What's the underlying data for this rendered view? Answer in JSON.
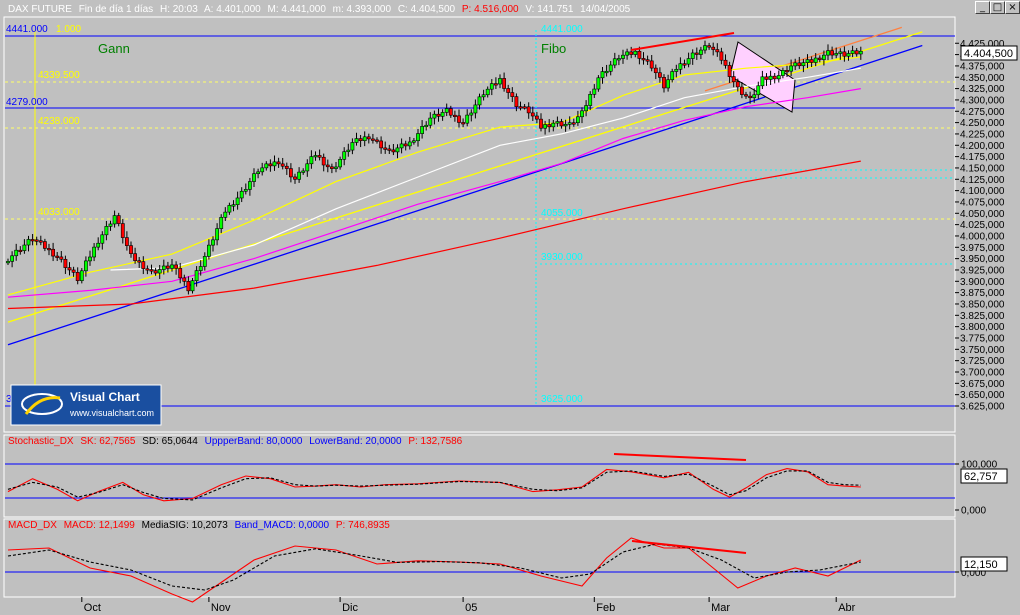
{
  "window": {
    "buttons": [
      "_",
      "□",
      "×"
    ]
  },
  "price_header": {
    "symbol": "DAX FUTURE",
    "period": "Fin de día 1 días",
    "H": "H: 20:03",
    "A": "A: 4.401,000",
    "M": "M: 4.441,000",
    "m": "m: 4.393,000",
    "C": "C: 4.404,500",
    "P": "P: 4.516,000",
    "V": "V: 141.751",
    "date": "14/04/2005"
  },
  "annotations": {
    "gann": "Gann",
    "fibo": "Fibo",
    "label_4441_left": "4441.000",
    "label_4441_yellow": "1.000",
    "label_4339": "4339.500",
    "label_4279": "4279.000",
    "label_4238": "4238.000",
    "label_4033": "4033.000",
    "label_4441_fibo": "4441.000",
    "label_4055": "4055.000",
    "label_3930": "3930.000",
    "label_3625": "3625.000",
    "label_left_3": "3"
  },
  "current_price": "4.404,500",
  "logo": {
    "name": "Visual Chart",
    "url": "www.visualchart.com"
  },
  "stoch_header": {
    "name": "Stochastic_DX",
    "sk": "SK: 62,7565",
    "sd": "SD: 65,0644",
    "upper": "UppperBand: 80,0000",
    "lower": "LowerBand: 20,0000",
    "p": "P: 132,7586"
  },
  "stoch_current": "62,757",
  "macd_header": {
    "name": "MACD_DX",
    "macd": "MACD: 12,1499",
    "signal": "MediaSIG: 10,2073",
    "band": "Band_MACD: 0,0000",
    "p": "P: 746,8935"
  },
  "macd_current": "12,150",
  "colors": {
    "background": "#c0c0c0",
    "up_candle": "#00ff00",
    "down_candle": "#ff0000",
    "grid_yellow": "#ffff00",
    "trend_blue": "#0000ff",
    "ma_red": "#ff0000",
    "ma_magenta": "#ff00ff"
  },
  "chart_data": [
    {
      "type": "candlestick",
      "title": "DAX FUTURE",
      "x_labels": [
        "Oct",
        "Nov",
        "Dic",
        "05",
        "Feb",
        "Mar",
        "Abr"
      ],
      "y_ticks": [
        "4.425,000",
        "4.400,000",
        "4.375,000",
        "4.350,000",
        "4.325,000",
        "4.300,000",
        "4.275,000",
        "4.250,000",
        "4.225,000",
        "4.200,000",
        "4.175,000",
        "4.150,000",
        "4.125,000",
        "4.100,000",
        "4.075,000",
        "4.050,000",
        "4.025,000",
        "4.000,000",
        "3.975,000",
        "3.950,000",
        "3.925,000",
        "3.900,000",
        "3.875,000",
        "3.850,000",
        "3.825,000",
        "3.800,000",
        "3.775,000",
        "3.750,000",
        "3.725,000",
        "3.700,000",
        "3.675,000",
        "3.650,000",
        "3.625,000"
      ],
      "ylim": [
        3610,
        4450
      ],
      "close_path": [
        [
          0,
          3950
        ],
        [
          6,
          3995
        ],
        [
          12,
          3955
        ],
        [
          17,
          3905
        ],
        [
          22,
          3990
        ],
        [
          26,
          4045
        ],
        [
          30,
          3955
        ],
        [
          35,
          3920
        ],
        [
          40,
          3935
        ],
        [
          44,
          3885
        ],
        [
          48,
          3955
        ],
        [
          53,
          4055
        ],
        [
          57,
          4095
        ],
        [
          61,
          4145
        ],
        [
          66,
          4165
        ],
        [
          70,
          4125
        ],
        [
          75,
          4180
        ],
        [
          79,
          4145
        ],
        [
          84,
          4205
        ],
        [
          88,
          4220
        ],
        [
          93,
          4185
        ],
        [
          98,
          4205
        ],
        [
          103,
          4260
        ],
        [
          107,
          4275
        ],
        [
          111,
          4250
        ],
        [
          116,
          4315
        ],
        [
          120,
          4345
        ],
        [
          124,
          4290
        ],
        [
          127,
          4275
        ],
        [
          130,
          4240
        ],
        [
          133,
          4250
        ],
        [
          137,
          4245
        ],
        [
          140,
          4270
        ],
        [
          144,
          4350
        ],
        [
          149,
          4395
        ],
        [
          153,
          4405
        ],
        [
          157,
          4375
        ],
        [
          160,
          4330
        ],
        [
          163,
          4370
        ],
        [
          167,
          4400
        ],
        [
          171,
          4420
        ],
        [
          174,
          4390
        ],
        [
          178,
          4325
        ],
        [
          181,
          4300
        ],
        [
          184,
          4345
        ],
        [
          188,
          4355
        ],
        [
          191,
          4375
        ],
        [
          196,
          4385
        ],
        [
          200,
          4405
        ],
        [
          204,
          4400
        ],
        [
          208,
          4405
        ]
      ],
      "series": [
        {
          "name": "MA rápida (amarilla)",
          "points": [
            [
              0,
              3870
            ],
            [
              20,
              3920
            ],
            [
              40,
              3960
            ],
            [
              60,
              4035
            ],
            [
              80,
              4120
            ],
            [
              100,
              4185
            ],
            [
              120,
              4240
            ],
            [
              135,
              4250
            ],
            [
              150,
              4310
            ],
            [
              165,
              4355
            ],
            [
              180,
              4370
            ],
            [
              195,
              4380
            ],
            [
              208,
              4395
            ]
          ]
        },
        {
          "name": "MA (blanca)",
          "points": [
            [
              25,
              3925
            ],
            [
              40,
              3930
            ],
            [
              60,
              3980
            ],
            [
              80,
              4060
            ],
            [
              100,
              4130
            ],
            [
              120,
              4200
            ],
            [
              135,
              4225
            ],
            [
              150,
              4260
            ],
            [
              165,
              4305
            ],
            [
              180,
              4330
            ],
            [
              195,
              4350
            ],
            [
              208,
              4370
            ]
          ]
        },
        {
          "name": "MA (magenta)",
          "points": [
            [
              0,
              3865
            ],
            [
              20,
              3880
            ],
            [
              40,
              3900
            ],
            [
              60,
              3950
            ],
            [
              80,
              4010
            ],
            [
              100,
              4070
            ],
            [
              120,
              4120
            ],
            [
              135,
              4160
            ],
            [
              150,
              4215
            ],
            [
              165,
              4255
            ],
            [
              180,
              4285
            ],
            [
              195,
              4305
            ],
            [
              208,
              4325
            ]
          ]
        },
        {
          "name": "MA lenta (roja)",
          "points": [
            [
              0,
              3840
            ],
            [
              30,
              3850
            ],
            [
              60,
              3885
            ],
            [
              90,
              3935
            ],
            [
              120,
              3995
            ],
            [
              150,
              4060
            ],
            [
              180,
              4120
            ],
            [
              208,
              4165
            ]
          ]
        }
      ],
      "trendlines": [
        {
          "from": [
            0,
            3760
          ],
          "to": [
            223,
            4420
          ],
          "color": "blue"
        },
        {
          "from": [
            0,
            3810
          ],
          "to": [
            223,
            4450
          ],
          "color": "yellow"
        },
        {
          "from": [
            170,
            4320
          ],
          "to": [
            218,
            4460
          ],
          "color": "orange"
        }
      ],
      "levels": [
        4441,
        4339.5,
        4279,
        4238,
        4033,
        3625
      ]
    },
    {
      "type": "line",
      "title": "Stochastic_DX",
      "ylim": [
        0,
        115
      ],
      "y_ticks": [
        "100,000",
        "0,000"
      ],
      "bands": [
        80,
        20
      ],
      "series": [
        {
          "name": "SK",
          "points": [
            [
              0,
              40
            ],
            [
              6,
              68
            ],
            [
              12,
              45
            ],
            [
              17,
              20
            ],
            [
              22,
              40
            ],
            [
              28,
              60
            ],
            [
              33,
              33
            ],
            [
              38,
              20
            ],
            [
              45,
              25
            ],
            [
              52,
              55
            ],
            [
              58,
              74
            ],
            [
              64,
              68
            ],
            [
              70,
              50
            ],
            [
              75,
              52
            ],
            [
              80,
              55
            ],
            [
              86,
              50
            ],
            [
              92,
              55
            ],
            [
              100,
              57
            ],
            [
              110,
              63
            ],
            [
              120,
              60
            ],
            [
              128,
              40
            ],
            [
              134,
              44
            ],
            [
              140,
              50
            ],
            [
              146,
              88
            ],
            [
              152,
              83
            ],
            [
              160,
              70
            ],
            [
              166,
              82
            ],
            [
              172,
              45
            ],
            [
              176,
              28
            ],
            [
              180,
              48
            ],
            [
              185,
              77
            ],
            [
              190,
              90
            ],
            [
              195,
              83
            ],
            [
              200,
              55
            ],
            [
              204,
              52
            ],
            [
              208,
              50
            ]
          ]
        },
        {
          "name": "SD",
          "points": [
            [
              0,
              45
            ],
            [
              6,
              60
            ],
            [
              12,
              50
            ],
            [
              17,
              28
            ],
            [
              22,
              38
            ],
            [
              28,
              55
            ],
            [
              33,
              38
            ],
            [
              38,
              25
            ],
            [
              45,
              22
            ],
            [
              52,
              48
            ],
            [
              58,
              68
            ],
            [
              64,
              70
            ],
            [
              70,
              55
            ],
            [
              75,
              52
            ],
            [
              80,
              54
            ],
            [
              86,
              52
            ],
            [
              92,
              54
            ],
            [
              100,
              56
            ],
            [
              110,
              62
            ],
            [
              120,
              60
            ],
            [
              128,
              45
            ],
            [
              134,
              42
            ],
            [
              140,
              48
            ],
            [
              146,
              82
            ],
            [
              152,
              85
            ],
            [
              160,
              73
            ],
            [
              166,
              78
            ],
            [
              172,
              52
            ],
            [
              176,
              33
            ],
            [
              180,
              42
            ],
            [
              185,
              70
            ],
            [
              190,
              85
            ],
            [
              195,
              85
            ],
            [
              200,
              60
            ],
            [
              204,
              55
            ],
            [
              208,
              54
            ]
          ]
        }
      ]
    },
    {
      "type": "line",
      "title": "MACD_DX",
      "y_ticks": [
        "0,000"
      ],
      "series": [
        {
          "name": "MACD",
          "points": [
            [
              0,
              55
            ],
            [
              10,
              60
            ],
            [
              20,
              10
            ],
            [
              30,
              -10
            ],
            [
              40,
              -55
            ],
            [
              45,
              -75
            ],
            [
              50,
              -40
            ],
            [
              60,
              30
            ],
            [
              70,
              65
            ],
            [
              80,
              55
            ],
            [
              90,
              20
            ],
            [
              100,
              28
            ],
            [
              110,
              25
            ],
            [
              120,
              20
            ],
            [
              130,
              -10
            ],
            [
              140,
              -35
            ],
            [
              146,
              35
            ],
            [
              152,
              85
            ],
            [
              160,
              60
            ],
            [
              166,
              60
            ],
            [
              172,
              10
            ],
            [
              178,
              -40
            ],
            [
              185,
              -10
            ],
            [
              192,
              10
            ],
            [
              200,
              -10
            ],
            [
              208,
              30
            ]
          ]
        },
        {
          "name": "MediaSIG",
          "points": [
            [
              0,
              40
            ],
            [
              10,
              55
            ],
            [
              20,
              25
            ],
            [
              30,
              5
            ],
            [
              40,
              -35
            ],
            [
              48,
              -45
            ],
            [
              55,
              -20
            ],
            [
              65,
              40
            ],
            [
              75,
              58
            ],
            [
              85,
              42
            ],
            [
              95,
              24
            ],
            [
              105,
              26
            ],
            [
              115,
              23
            ],
            [
              125,
              10
            ],
            [
              135,
              -15
            ],
            [
              142,
              -5
            ],
            [
              150,
              50
            ],
            [
              158,
              70
            ],
            [
              166,
              60
            ],
            [
              174,
              30
            ],
            [
              182,
              -15
            ],
            [
              190,
              0
            ],
            [
              198,
              5
            ],
            [
              208,
              25
            ]
          ]
        }
      ]
    }
  ]
}
